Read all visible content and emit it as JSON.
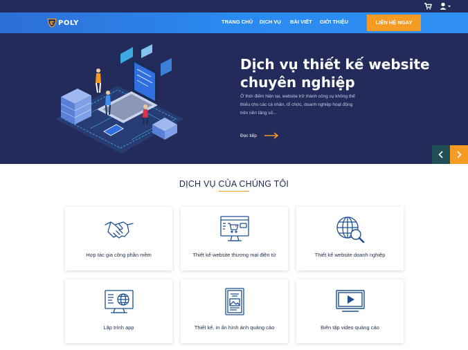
{
  "header": {
    "brand": "POLY",
    "icons": [
      "cart-icon",
      "user-icon"
    ]
  },
  "nav": {
    "items": [
      "TRANG CHỦ",
      "DỊCH VỤ",
      "BÀI VIẾT",
      "GIỚI THIỆU"
    ],
    "cta": "LIÊN HỆ NGAY"
  },
  "hero": {
    "title_line1": "Dịch vụ thiết kế website",
    "title_line2": "chuyên nghiệp",
    "description": "Ở thời điểm hiện tại, website trở thành công cụ không thể thiếu cho các cá nhân, tổ chức, doanh nghiệp hoạt động trên nền tảng số...",
    "read_more": "Đọc tiếp"
  },
  "services": {
    "title": "DỊCH VỤ CỦA CHÚNG TÔI",
    "items": [
      {
        "label": "Hợp tác gia công phần mềm",
        "icon": "handshake-icon"
      },
      {
        "label": "Thiết kế website thương mại điện tử",
        "icon": "ecommerce-icon"
      },
      {
        "label": "Thiết kế website doanh nghiệp",
        "icon": "globe-search-icon"
      },
      {
        "label": "Lập trình app",
        "icon": "monitor-globe-icon"
      },
      {
        "label": "Thiết kế, in ấn hình ảnh quảng cáo",
        "icon": "print-document-icon"
      },
      {
        "label": "Biên tập video quảng cáo",
        "icon": "video-play-icon"
      }
    ]
  },
  "colors": {
    "topbar": "#232b5b",
    "navbar": "#2a8af0",
    "hero_bg": "#232b5b",
    "accent": "#f59a23",
    "text_dark": "#1c2a4a",
    "icon_blue": "#1d4f91"
  }
}
